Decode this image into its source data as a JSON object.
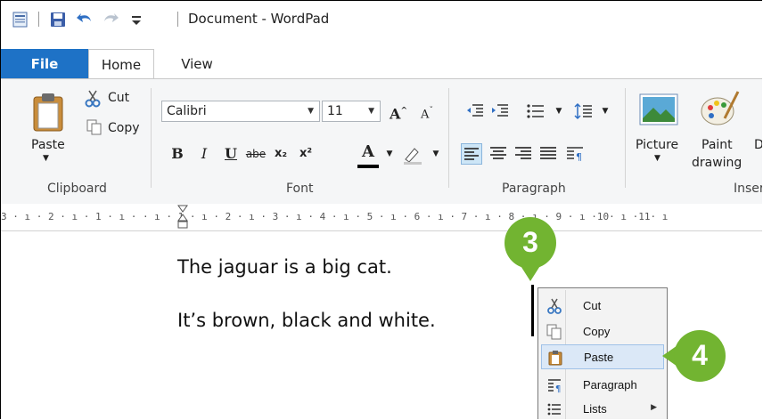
{
  "window": {
    "title": "Document - WordPad"
  },
  "quick_access": {
    "icons": [
      "app-menu-icon",
      "save-icon",
      "undo-icon",
      "redo-icon",
      "customize-qat-icon"
    ]
  },
  "tabs": {
    "file": "File",
    "home": "Home",
    "view": "View"
  },
  "ribbon": {
    "clipboard": {
      "label": "Clipboard",
      "paste": "Paste",
      "cut": "Cut",
      "copy": "Copy"
    },
    "font": {
      "label": "Font",
      "family": "Calibri",
      "size": "11",
      "bold": "B",
      "italic": "I",
      "underline": "U",
      "strike": "abe",
      "subscript": "x₂",
      "superscript": "x²",
      "color_a": "A"
    },
    "paragraph": {
      "label": "Paragraph"
    },
    "insert": {
      "label": "Inser",
      "picture": "Picture",
      "paint_drawing_1": "Paint",
      "paint_drawing_2": "drawing",
      "next_cut": "D"
    }
  },
  "ruler": {
    "text": "3 · ı · 2 · ı · 1 · ı ·   · ı · 1 · ı · 2 · ı · 3 · ı · 4 · ı · 5 · ı · 6 · ı · 7 · ı · 8 · ı · 9 · ı ·10· ı ·11· ı"
  },
  "document": {
    "line1": "The jaguar is a big cat.",
    "line2": "It’s brown, black and white."
  },
  "callouts": {
    "step3": "3",
    "step4": "4"
  },
  "context_menu": {
    "items": [
      {
        "label": "Cut",
        "icon": "scissors-icon"
      },
      {
        "label": "Copy",
        "icon": "copy-icon"
      },
      {
        "label": "Paste",
        "icon": "clipboard-icon",
        "highlighted": true
      },
      {
        "label": "Paragraph",
        "icon": "paragraph-icon"
      },
      {
        "label": "Lists",
        "icon": "list-icon",
        "has_submenu": true
      }
    ]
  },
  "colors": {
    "file_tab": "#1e72c6",
    "callout": "#72b431",
    "menu_highlight": "#dbe8f7"
  }
}
